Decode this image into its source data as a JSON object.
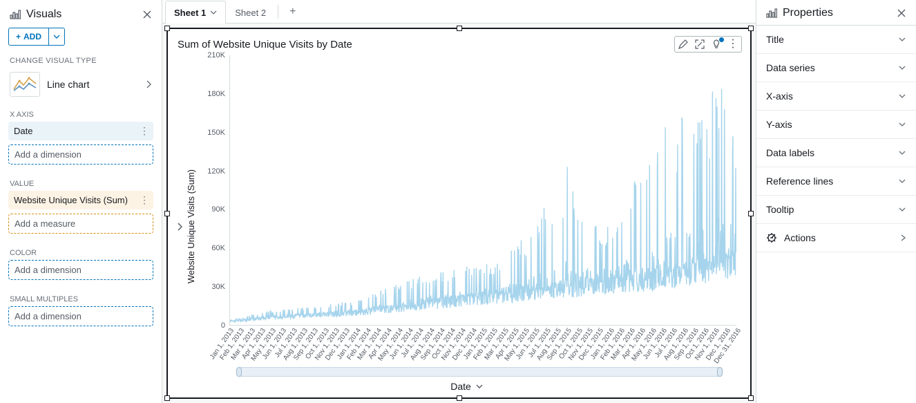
{
  "left": {
    "title": "Visuals",
    "add_label": "ADD",
    "change_type_label": "CHANGE VISUAL TYPE",
    "visual_type": "Line chart",
    "groups": {
      "xaxis": {
        "label": "X AXIS",
        "field": "Date",
        "placeholder": "Add a dimension"
      },
      "value": {
        "label": "VALUE",
        "field": "Website Unique Visits (Sum)",
        "placeholder": "Add a measure"
      },
      "color": {
        "label": "COLOR",
        "placeholder": "Add a dimension"
      },
      "small_multiples": {
        "label": "SMALL MULTIPLES",
        "placeholder": "Add a dimension"
      }
    }
  },
  "tabs": {
    "items": [
      "Sheet 1",
      "Sheet 2"
    ],
    "active_index": 0
  },
  "viz": {
    "title": "Sum of Website Unique Visits by Date",
    "ylabel": "Website Unique Visits (Sum)",
    "xlabel": "Date"
  },
  "right": {
    "title": "Properties",
    "sections": [
      "Title",
      "Data series",
      "X-axis",
      "Y-axis",
      "Data labels",
      "Reference lines",
      "Tooltip"
    ],
    "actions_label": "Actions"
  },
  "chart_data": {
    "type": "line",
    "title": "Sum of Website Unique Visits by Date",
    "xlabel": "Date",
    "ylabel": "Website Unique Visits (Sum)",
    "ylim": [
      0,
      210000
    ],
    "yticks": [
      0,
      30000,
      60000,
      90000,
      120000,
      150000,
      180000,
      210000
    ],
    "ytick_labels": [
      "0",
      "30K",
      "60K",
      "90K",
      "120K",
      "150K",
      "180K",
      "210K"
    ],
    "xticks": [
      "Jan 1, 2013",
      "Feb 1, 2013",
      "Mar 1, 2013",
      "Apr 1, 2013",
      "May 1, 2013",
      "Jun 1, 2013",
      "Jul 1, 2013",
      "Aug 1, 2013",
      "Sep 1, 2013",
      "Oct 1, 2013",
      "Nov 1, 2013",
      "Dec 1, 2013",
      "Jan 1, 2014",
      "Feb 1, 2014",
      "Mar 1, 2014",
      "Apr 1, 2014",
      "May 1, 2014",
      "Jun 1, 2014",
      "Jul 1, 2014",
      "Aug 1, 2014",
      "Sep 1, 2014",
      "Oct 1, 2014",
      "Nov 1, 2014",
      "Dec 1, 2014",
      "Jan 1, 2015",
      "Feb 1, 2015",
      "Mar 1, 2015",
      "Apr 1, 2015",
      "May 1, 2015",
      "Jun 1, 2015",
      "Jul 1, 2015",
      "Aug 1, 2015",
      "Sep 1, 2015",
      "Oct 1, 2015",
      "Nov 1, 2015",
      "Dec 1, 2015",
      "Jan 1, 2016",
      "Feb 1, 2016",
      "Mar 1, 2016",
      "Apr 1, 2016",
      "May 1, 2016",
      "Jun 1, 2016",
      "Jul 1, 2016",
      "Aug 1, 2016",
      "Sep 1, 2016",
      "Oct 1, 2016",
      "Nov 1, 2016",
      "Dec 1, 2016",
      "Dec 31, 2016"
    ],
    "monthly_baseline": [
      3000,
      3500,
      4500,
      5500,
      6000,
      6500,
      7000,
      7500,
      8000,
      8500,
      9000,
      9500,
      10000,
      11000,
      12000,
      13000,
      14000,
      15000,
      16000,
      17000,
      18000,
      19000,
      20000,
      21000,
      22000,
      23000,
      24000,
      25000,
      26000,
      27000,
      28000,
      29000,
      30000,
      31000,
      32000,
      33000,
      34000,
      35000,
      36000,
      37000,
      38000,
      39000,
      40000,
      42000,
      44000,
      46000,
      48000,
      50000,
      50000
    ],
    "monthly_spike_max": [
      5000,
      6000,
      8000,
      10000,
      12000,
      12000,
      13000,
      14000,
      15000,
      16000,
      17000,
      18000,
      20000,
      22000,
      26000,
      30000,
      32000,
      35000,
      38000,
      40000,
      42000,
      44000,
      45000,
      46000,
      46000,
      50000,
      55000,
      60000,
      70000,
      80000,
      100000,
      110000,
      125000,
      90000,
      85000,
      80000,
      78000,
      80000,
      110000,
      115000,
      130000,
      165000,
      170000,
      160000,
      175000,
      170000,
      190000,
      195000,
      138000
    ],
    "color": "#a6d4ec"
  }
}
